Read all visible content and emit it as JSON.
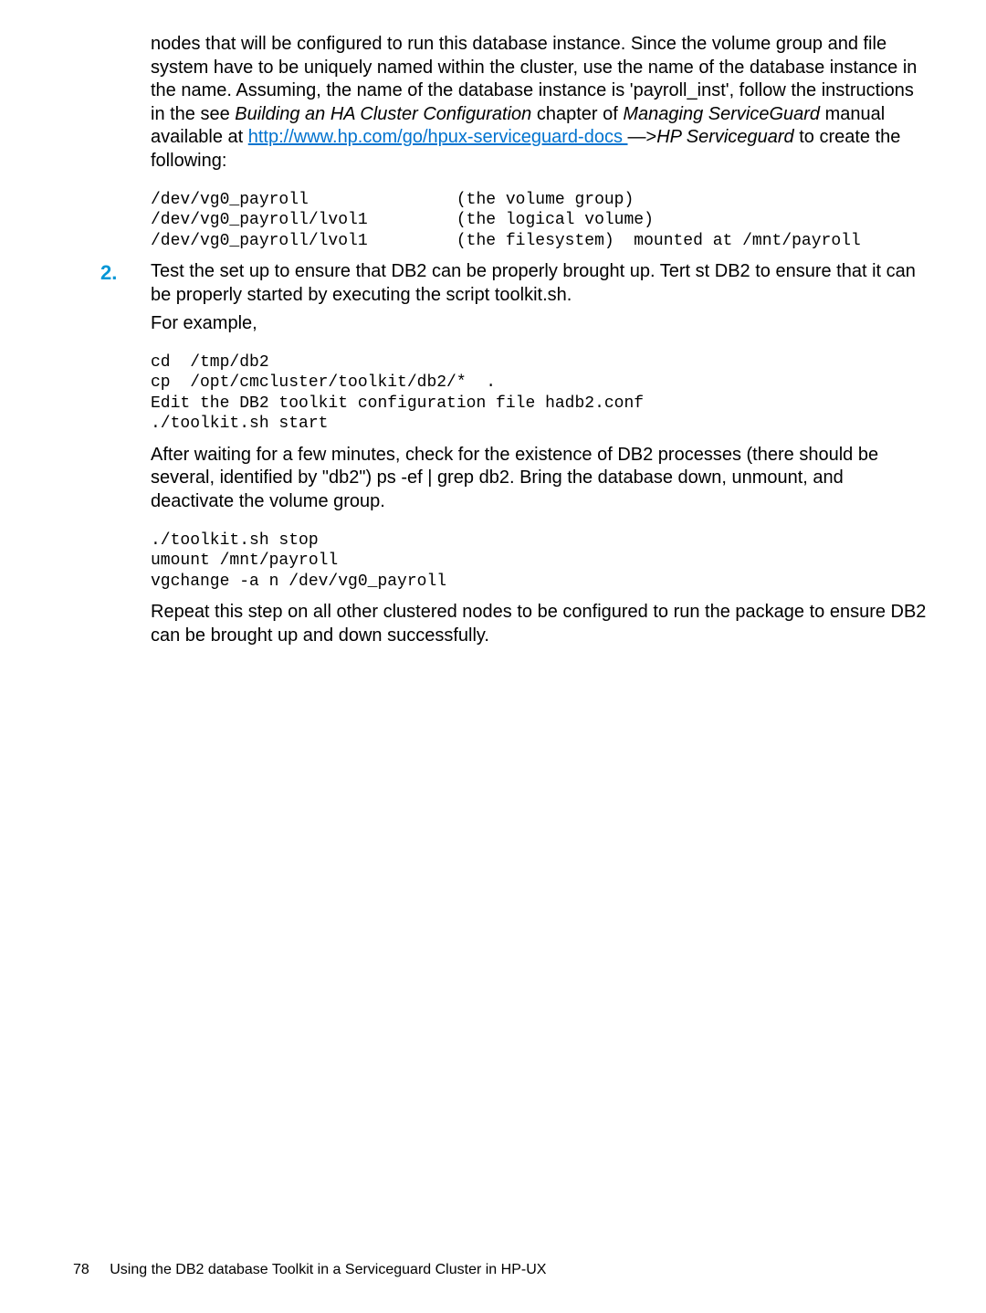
{
  "p1_a": "nodes that will be configured to run this database instance. Since the volume group and file system have to be uniquely named within the cluster, use the name of the database instance in the name. Assuming, the name of the database instance is 'payroll_inst', follow the instructions in the see ",
  "p1_em1": "Building an HA Cluster Configuration",
  "p1_b": " chapter of ",
  "p1_em2": "Managing ServiceGuard",
  "p1_c": " manual available at ",
  "p1_link": "http://www.hp.com/go/hpux-serviceguard-docs ",
  "p1_d": " —>",
  "p1_em3": "HP Serviceguard",
  "p1_e": " to create the following:",
  "code1": "/dev/vg0_payroll               (the volume group)\n/dev/vg0_payroll/lvol1         (the logical volume)\n/dev/vg0_payroll/lvol1         (the filesystem)  mounted at /mnt/payroll",
  "step2_num": "2.",
  "step2_p1": "Test the set up to ensure that DB2 can be properly brought up. Tert st DB2 to ensure that it can be properly started by executing the script toolkit.sh.",
  "step2_p2": "For example,",
  "code2": "cd  /tmp/db2\ncp  /opt/cmcluster/toolkit/db2/*  .\nEdit the DB2 toolkit configuration file hadb2.conf\n./toolkit.sh start",
  "step2_p3": "After waiting for a few minutes, check for the existence of DB2 processes (there should be several, identified by \"db2\") ps -ef | grep db2. Bring the database down, unmount, and deactivate the volume group.",
  "code3": "./toolkit.sh stop\numount /mnt/payroll\nvgchange -a n /dev/vg0_payroll",
  "step2_p4": "Repeat this step on all other clustered nodes to be configured to run the package to ensure DB2 can be brought up and down successfully.",
  "footer_page": "78",
  "footer_text": "Using the DB2 database Toolkit in a Serviceguard Cluster in HP-UX"
}
